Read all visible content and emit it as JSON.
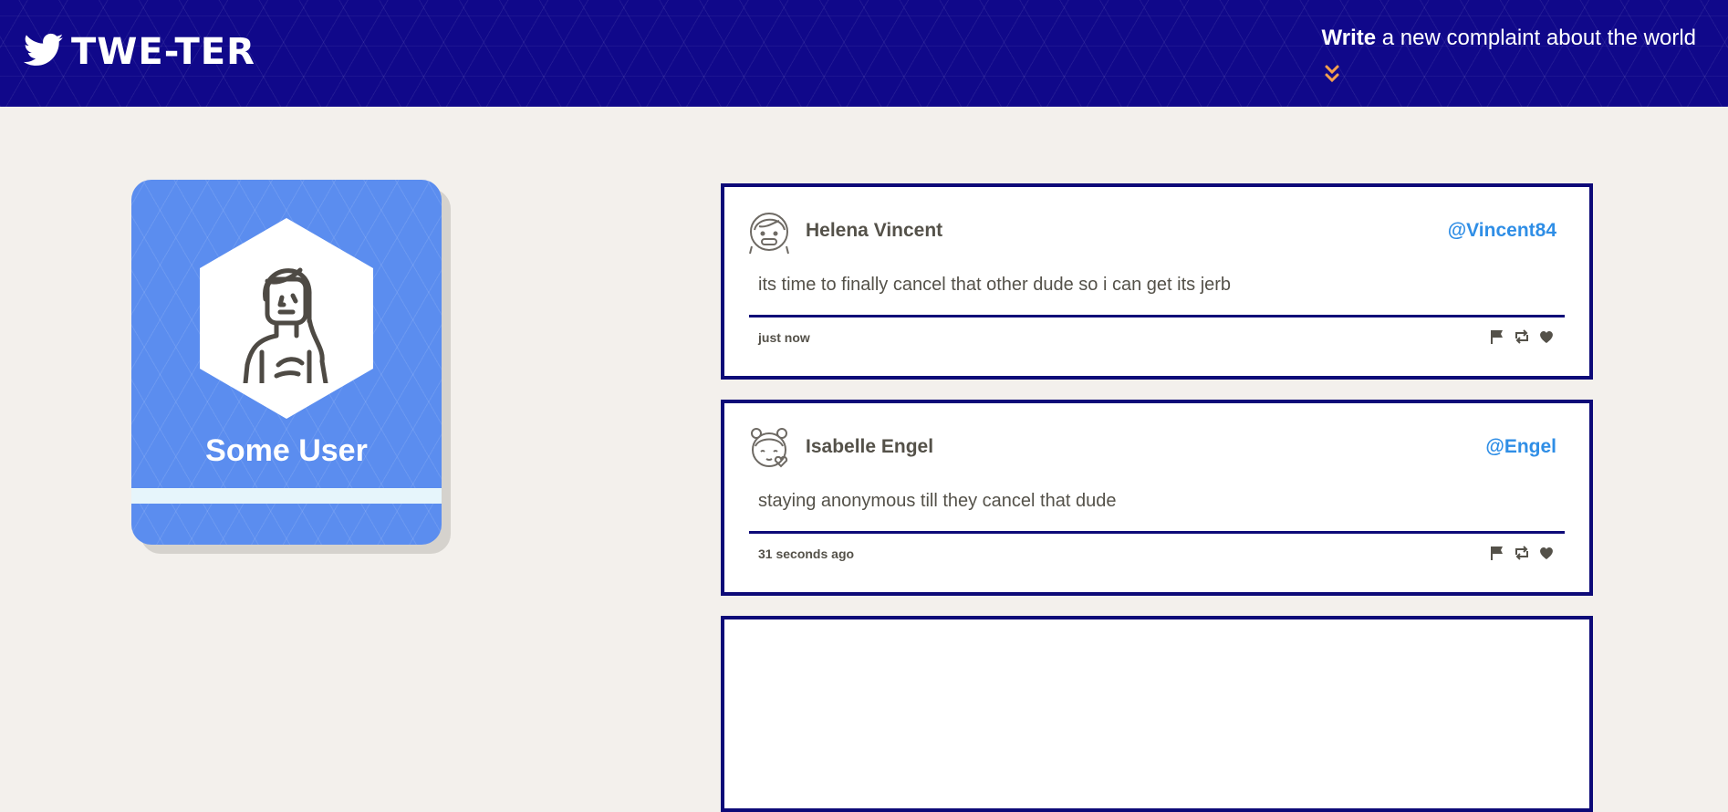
{
  "nav": {
    "brand": "TWE-TER",
    "compose_bold": "Write",
    "compose_rest": " a new complaint about the world",
    "accent": "#10088a",
    "arrow_color": "#f5a04d"
  },
  "profile": {
    "name": "Some User",
    "card_color": "#5b8def"
  },
  "tweets": [
    {
      "name": "Helena Vincent",
      "handle": "@Vincent84",
      "text": "its time to finally cancel that other dude so i can get its jerb",
      "time": "just now",
      "avatar_icon": "girl-avatar-icon"
    },
    {
      "name": "Isabelle Engel",
      "handle": "@Engel",
      "text": "staying anonymous till they cancel that dude",
      "time": "31 seconds ago",
      "avatar_icon": "girl-buns-avatar-icon"
    }
  ],
  "actions": [
    "flag-icon",
    "retweet-icon",
    "heart-icon"
  ]
}
